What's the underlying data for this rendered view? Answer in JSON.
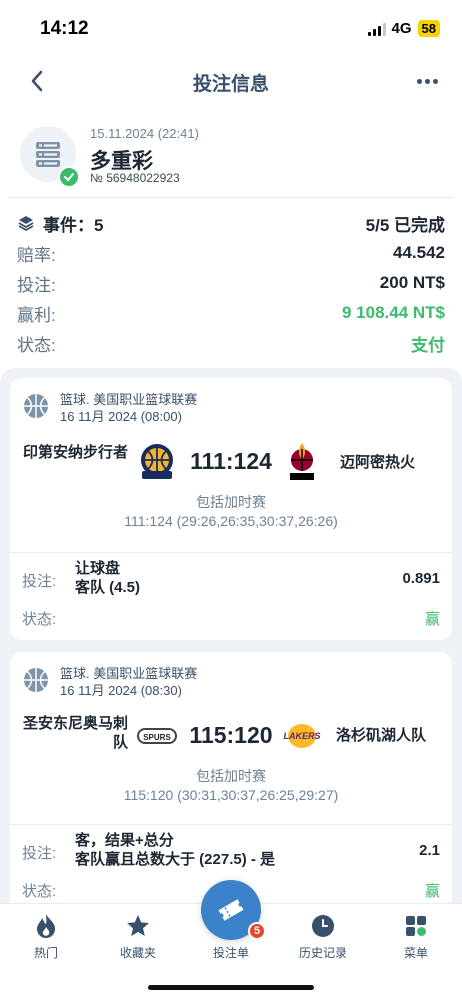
{
  "status_bar": {
    "time": "14:12",
    "network": "4G",
    "battery": "58"
  },
  "header": {
    "title": "投注信息",
    "back_icon": "chevron-left-icon",
    "more_icon": "more-horizontal-icon"
  },
  "bet": {
    "date": "15.11.2024 (22:41)",
    "type": "多重彩",
    "number": "№ 56948022923"
  },
  "info": {
    "events_label": "事件：5",
    "events_value": "5/5 已完成",
    "odds_label": "赔率:",
    "odds_value": "44.542",
    "stake_label": "投注:",
    "stake_value": "200 NT$",
    "profit_label": "赢利:",
    "profit_value": "9 108.44 NT$",
    "status_label": "状态:",
    "status_value": "支付"
  },
  "colors": {
    "accent": "#3b82c8",
    "win": "#3dbb6c",
    "title": "#38506b",
    "badge": "#e8442f"
  },
  "events": [
    {
      "league": "篮球. 美国职业篮球联赛",
      "date": "16 11月 2024 (08:00)",
      "home": "印第安纳步行者",
      "away": "迈阿密热火",
      "score": "111:124",
      "ot_label": "包括加时赛",
      "periods": "111:124 (29:26,26:35,30:37,26:26)",
      "bet_label": "投注:",
      "market_line1": "让球盘",
      "market_line2": "客队 (4.5)",
      "odds": "0.891",
      "status_label": "状态:",
      "result": "赢"
    },
    {
      "league": "篮球. 美国职业篮球联赛",
      "date": "16 11月 2024 (08:30)",
      "home": "圣安东尼奥马刺队",
      "away": "洛杉矶湖人队",
      "score": "115:120",
      "ot_label": "包括加时赛",
      "periods": "115:120 (30:31,30:37,26:25,29:27)",
      "bet_label": "投注:",
      "market_line1": "客，结果+总分",
      "market_line2": "客队赢且总数大于 (227.5) - 是",
      "odds": "2.1",
      "status_label": "状态:",
      "result": "赢"
    }
  ],
  "nav": {
    "items": [
      {
        "label": "热门",
        "icon": "flame-icon"
      },
      {
        "label": "收藏夹",
        "icon": "star-icon"
      },
      {
        "label": "投注单",
        "icon": "ticket-icon",
        "badge": "5"
      },
      {
        "label": "历史记录",
        "icon": "clock-icon"
      },
      {
        "label": "菜单",
        "icon": "grid-icon"
      }
    ]
  }
}
